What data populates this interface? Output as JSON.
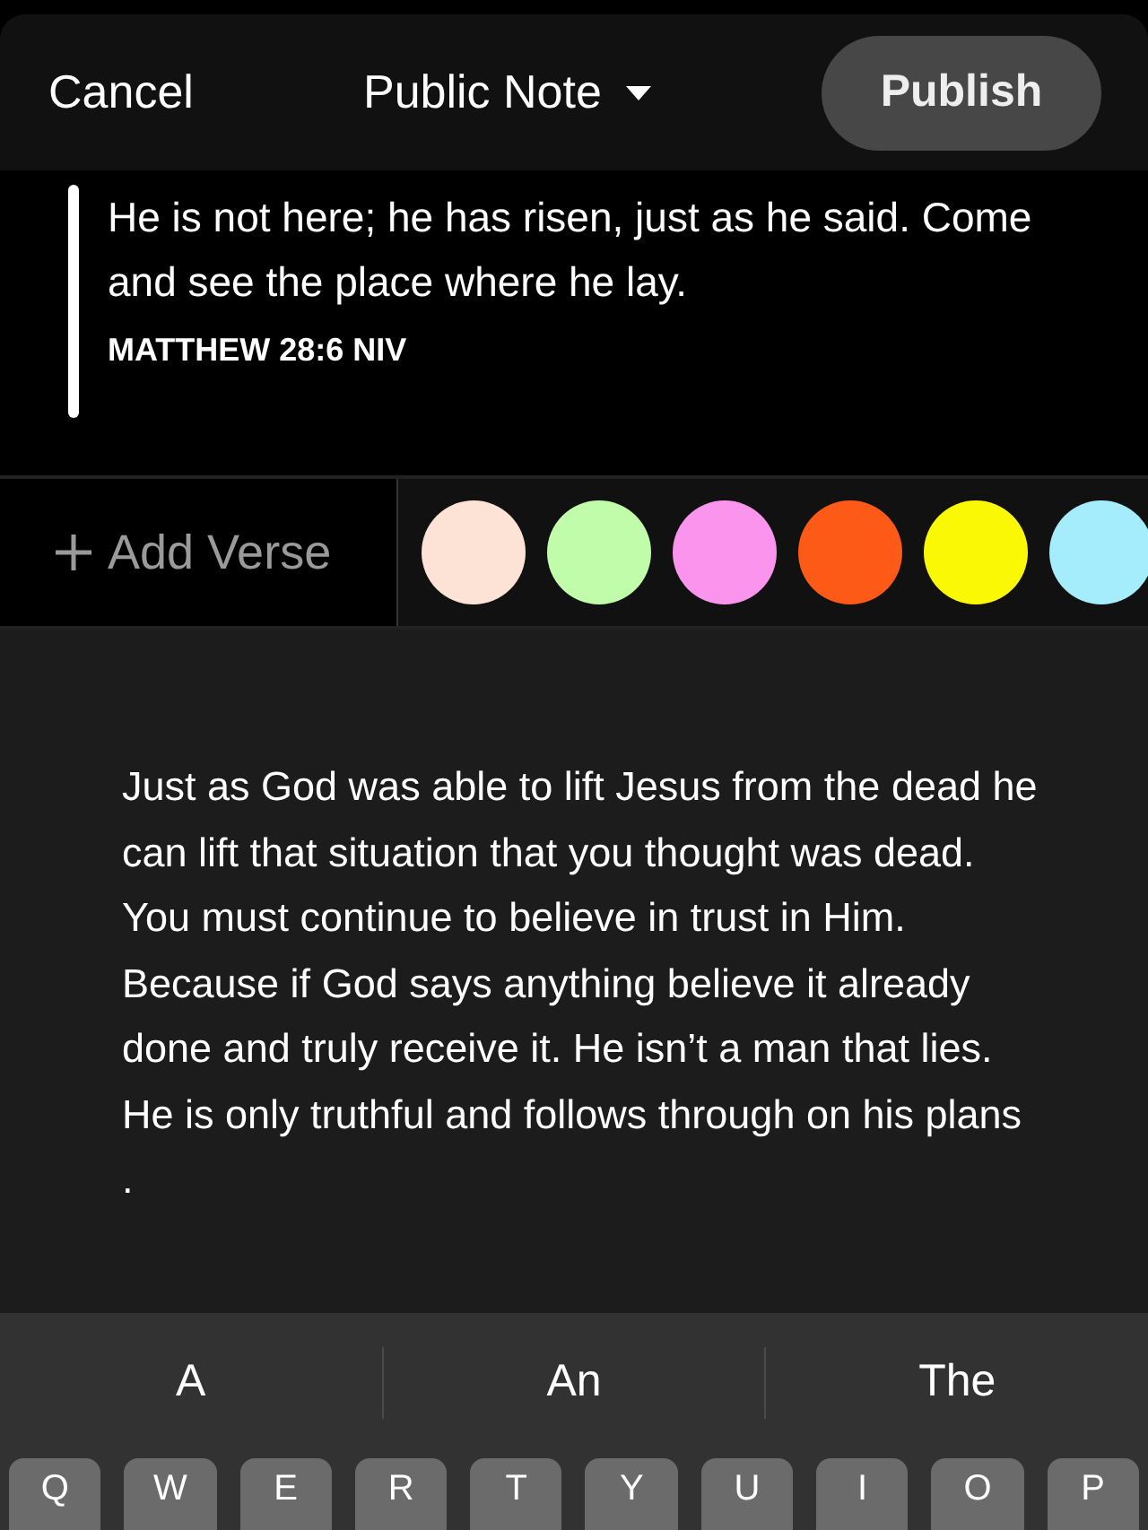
{
  "header": {
    "cancel": "Cancel",
    "title": "Public Note",
    "publish": "Publish"
  },
  "verse": {
    "text": "He is not here; he has risen, just as he said. Come and see the place where he lay.",
    "reference": "MATTHEW 28:6 NIV"
  },
  "toolbar": {
    "add_verse": "Add Verse",
    "swatches": [
      {
        "color": "#fde3d6"
      },
      {
        "color": "#c0fca9"
      },
      {
        "color": "#fb94ed"
      },
      {
        "color": "#fe5a17"
      },
      {
        "color": "#fbf805"
      },
      {
        "color": "#a5ecfc"
      }
    ]
  },
  "note": {
    "value": "Just as God was able to lift Jesus from the dead he can lift that situation that you thought was dead. You must continue to believe in trust in Him. Because if God says anything believe it already done and truly receive it. He isn’t a man that lies. He is only truthful and follows through on his plans ."
  },
  "keyboard": {
    "suggestions": [
      "A",
      "An",
      "The"
    ],
    "keys": [
      "Q",
      "W",
      "E",
      "R",
      "T",
      "Y",
      "U",
      "I",
      "O",
      "P"
    ]
  }
}
